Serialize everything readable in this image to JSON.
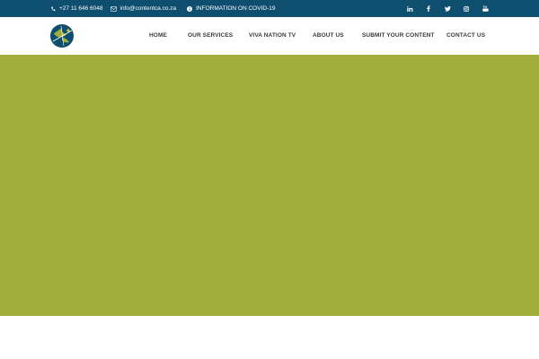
{
  "topbar": {
    "phone": "+27 11 646 6048",
    "email": "info@contentca.co.za",
    "covid": "INFORMATION ON COVID-19",
    "social": [
      "linkedin-icon",
      "facebook-icon",
      "twitter-icon",
      "instagram-icon",
      "youtube-icon"
    ],
    "background": "#0e4e6e"
  },
  "nav": {
    "items": [
      "HOME",
      "OUR SERVICES",
      "VIVA NATION TV",
      "ABOUT US",
      "SUBMIT YOUR CONTENT",
      "CONTACT US"
    ]
  },
  "hero": {
    "color": "#a2ad3a"
  }
}
